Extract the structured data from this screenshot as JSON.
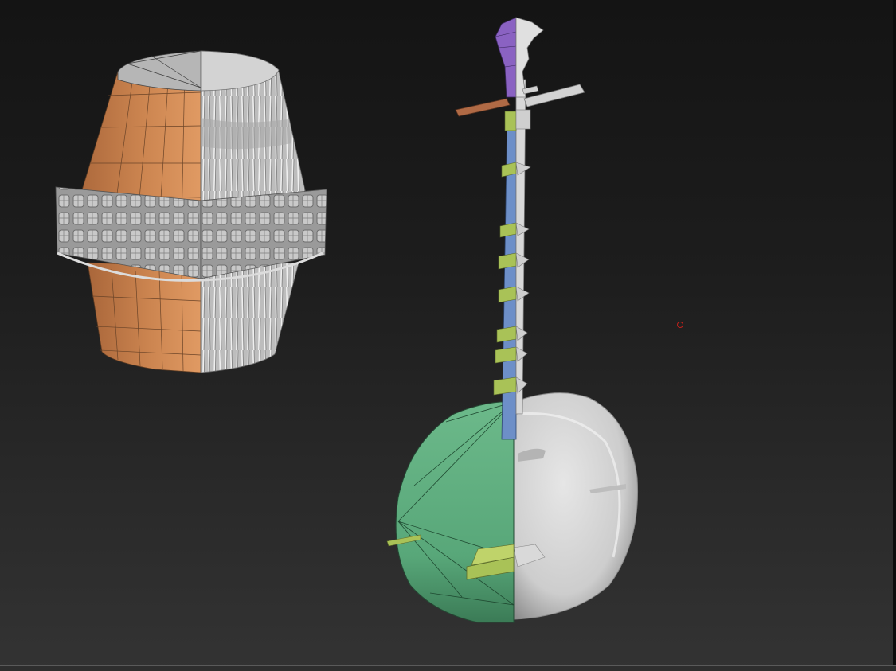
{
  "viewport": {
    "background_top": "#141414",
    "background_bottom": "#333333"
  },
  "models": {
    "drum": {
      "lowpoly_color": "#d88e5a",
      "sculpt_color": "#c9c9c9",
      "top_color": "#b8b8b8"
    },
    "lute": {
      "peg_head_color": "#8a62c2",
      "neck_color": "#6d8fc8",
      "fret_color": "#a9c257",
      "body_lowpoly_color": "#5aa97a",
      "tuning_peg_color": "#b06a45",
      "sculpt_color": "#cfcfcf"
    }
  },
  "cursor": {
    "color": "#c0201b"
  }
}
